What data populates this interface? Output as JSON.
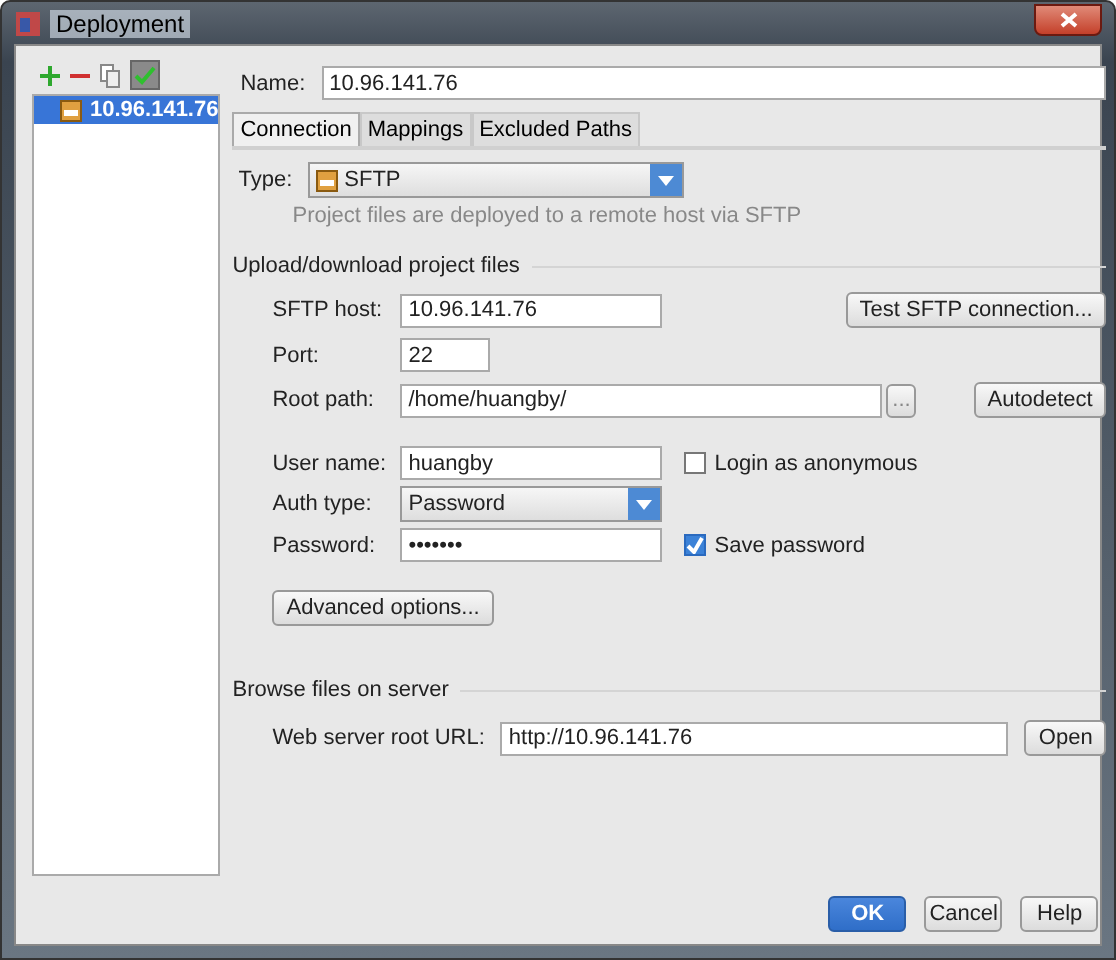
{
  "window": {
    "title": "Deployment"
  },
  "servers": [
    {
      "label": "10.96.141.76",
      "selected": true
    }
  ],
  "name": {
    "label": "Name:",
    "value": "10.96.141.76"
  },
  "tabs": [
    {
      "label": "Connection",
      "selected": true
    },
    {
      "label": "Mappings",
      "selected": false
    },
    {
      "label": "Excluded Paths",
      "selected": false
    }
  ],
  "type": {
    "label": "Type:",
    "value": "SFTP",
    "hint": "Project files are deployed to a remote host via SFTP"
  },
  "upload_section": {
    "title": "Upload/download project files",
    "connection_fields": [
      {
        "kind": "text",
        "label": "SFTP host:",
        "value": "10.96.141.76",
        "button": "Test SFTP connection..."
      },
      {
        "kind": "short",
        "label": "Port:",
        "value": "22"
      },
      {
        "kind": "path",
        "label": "Root path:",
        "value": "/home/huangby/",
        "browse": "...",
        "button": "Autodetect"
      }
    ],
    "login_fields": [
      {
        "kind": "text",
        "label": "User name:",
        "value": "huangby",
        "checkbox": {
          "label": "Login as anonymous",
          "checked": false
        }
      },
      {
        "kind": "select",
        "label": "Auth type:",
        "value": "Password"
      },
      {
        "kind": "text",
        "label": "Password:",
        "value": "•••••••",
        "checkbox": {
          "label": "Save password",
          "checked": true
        }
      }
    ],
    "advanced_button": "Advanced options..."
  },
  "browse_section": {
    "title": "Browse files on server",
    "label": "Web server root URL:",
    "value": "http://10.96.141.76",
    "button": "Open"
  },
  "buttons": [
    {
      "label": "OK",
      "primary": true
    },
    {
      "label": "Cancel",
      "primary": false
    },
    {
      "label": "Help",
      "primary": false
    }
  ]
}
